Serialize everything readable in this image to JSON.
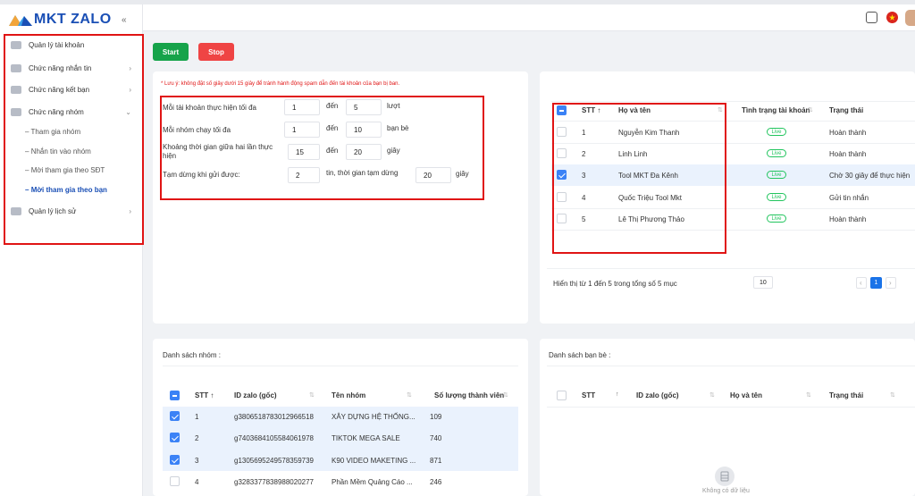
{
  "app": {
    "logo_text": "MKT ZALO",
    "collapse_glyph": "«"
  },
  "sidebar": {
    "items": [
      {
        "label": "Quản lý tài khoản",
        "icon": "account-icon",
        "arrow": ""
      },
      {
        "label": "Chức năng nhắn tin",
        "icon": "message-icon",
        "arrow": "›"
      },
      {
        "label": "Chức năng kết bạn",
        "icon": "add-friend-icon",
        "arrow": "›"
      },
      {
        "label": "Chức năng nhóm",
        "icon": "group-icon",
        "arrow": "⌄"
      },
      {
        "label": "Quản lý lịch sử",
        "icon": "history-icon",
        "arrow": "›"
      }
    ],
    "subitems": [
      {
        "label": "Tham gia nhóm"
      },
      {
        "label": "Nhắn tin vào nhóm"
      },
      {
        "label": "Mời tham gia theo SĐT"
      },
      {
        "label": "Mời tham gia theo bạn"
      }
    ],
    "sub_prefix": "–"
  },
  "toolbar": {
    "start_label": "Start",
    "stop_label": "Stop",
    "start_color": "#16a34a",
    "stop_color": "#ef4444"
  },
  "settings": {
    "warning": "* Lưu ý: không đặt số giây dưới 15 giây để tránh hành động spam dẫn đến tài khoản của bạn bị ban.",
    "rows": [
      {
        "label": "Mỗi tài khoản thực hiện tối đa",
        "from": "1",
        "mid": "đến",
        "to": "5",
        "unit": "lượt"
      },
      {
        "label": "Mỗi nhóm chạy tối đa",
        "from": "1",
        "mid": "đến",
        "to": "10",
        "unit": "bạn bè"
      },
      {
        "label": "Khoảng thời gian giữa hai lần thực hiện",
        "from": "15",
        "mid": "đến",
        "to": "20",
        "unit": "giây"
      },
      {
        "label": "Tạm dừng khi gửi được:",
        "from": "2",
        "mid": "tin, thời gian tạm dừng",
        "to": "20",
        "unit": "giây"
      }
    ]
  },
  "accounts": {
    "headers": {
      "stt": "STT",
      "name": "Họ và tên",
      "status": "Tình trạng tài khoản",
      "state": "Trạng thái"
    },
    "rows": [
      {
        "stt": "1",
        "name": "Nguyễn Kim Thanh",
        "status": "Live",
        "state": "Hoàn thành",
        "checked": false
      },
      {
        "stt": "2",
        "name": "Linh Linh",
        "status": "Live",
        "state": "Hoàn thành",
        "checked": false
      },
      {
        "stt": "3",
        "name": "Tool MKT Đa Kênh",
        "status": "Live",
        "state": "Chờ 30 giây để thực hiện",
        "checked": true
      },
      {
        "stt": "4",
        "name": "Quốc Triệu Tool Mkt",
        "status": "Live",
        "state": "Gửi tin nhắn",
        "checked": false
      },
      {
        "stt": "5",
        "name": "Lê Thị Phương Thảo",
        "status": "Live",
        "state": "Hoàn thành",
        "checked": false
      }
    ],
    "footer": "Hiển thị từ 1 đến 5 trong tổng số 5 mục",
    "page_size": "10",
    "current_page": "1",
    "prev": "‹",
    "next": "›"
  },
  "groups": {
    "title": "Danh sách nhóm :",
    "headers": {
      "stt": "STT",
      "id": "ID zalo (gốc)",
      "name": "Tên nhóm",
      "members": "Số lượng thành viên"
    },
    "rows": [
      {
        "stt": "1",
        "id": "g3806518783012966518",
        "name": "XÂY DỰNG HỆ THỐNG...",
        "members": "109",
        "checked": true
      },
      {
        "stt": "2",
        "id": "g7403684105584061978",
        "name": "TIKTOK MEGA SALE",
        "members": "740",
        "checked": true
      },
      {
        "stt": "3",
        "id": "g1305695249578359739",
        "name": "K90 VIDEO MAKETING ...",
        "members": "871",
        "checked": true
      },
      {
        "stt": "4",
        "id": "g3283377838988020277",
        "name": "Phần Mềm Quảng Cáo ...",
        "members": "246",
        "checked": false
      }
    ]
  },
  "friends": {
    "title": "Danh sách bạn bè :",
    "headers": {
      "stt": "STT",
      "id": "ID zalo (gốc)",
      "name": "Họ và tên",
      "state": "Trạng thái"
    },
    "empty": "Không có dữ liệu"
  },
  "colors": {
    "accent": "#1a4fb5",
    "highlight": "#eaf2fd",
    "danger": "#e01414",
    "live": "#22c55e"
  },
  "glyphs": {
    "sort_asc": "↑",
    "sort_both": "⇅"
  }
}
